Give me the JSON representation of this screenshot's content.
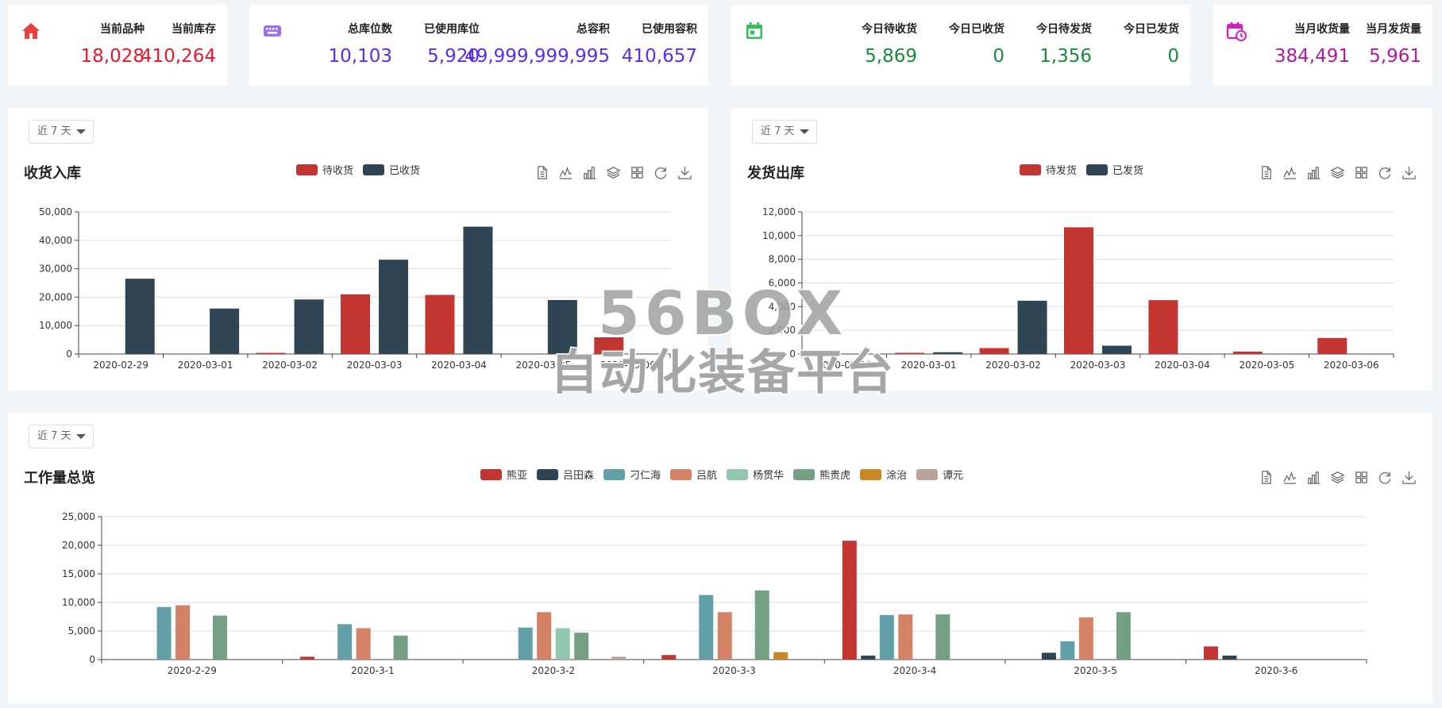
{
  "stats": {
    "card1": {
      "items": [
        {
          "label": "当前品种",
          "value": "18,028",
          "color": "#e8182a"
        },
        {
          "label": "当前库存",
          "value": "410,264",
          "color": "#e8182a"
        }
      ],
      "icon": "home-icon",
      "icon_color": "#e8403a"
    },
    "card2": {
      "items": [
        {
          "label": "总库位数",
          "value": "10,103",
          "color": "#5a2ee8"
        },
        {
          "label": "已使用库位",
          "value": "5,920",
          "color": "#5a2ee8"
        },
        {
          "label": "总容积",
          "value": "49,999,999,995",
          "color": "#5a2ee8"
        },
        {
          "label": "已使用容积",
          "value": "410,657",
          "color": "#5a2ee8"
        }
      ],
      "icon": "keyboard-icon",
      "icon_color": "#9b6fe8"
    },
    "card3": {
      "items": [
        {
          "label": "今日待收货",
          "value": "5,869",
          "color": "#1a8a3c"
        },
        {
          "label": "今日已收货",
          "value": "0",
          "color": "#1a8a3c"
        },
        {
          "label": "今日待发货",
          "value": "1,356",
          "color": "#1a8a3c"
        },
        {
          "label": "今日已发货",
          "value": "0",
          "color": "#1a8a3c"
        }
      ],
      "icon": "calendar-icon",
      "icon_color": "#2ec05a"
    },
    "card4": {
      "items": [
        {
          "label": "当月收货量",
          "value": "384,491",
          "color": "#b01aa0"
        },
        {
          "label": "当月发货量",
          "value": "5,961",
          "color": "#b01aa0"
        }
      ],
      "icon": "calendar-clock-icon",
      "icon_color": "#d420c0"
    }
  },
  "panels": {
    "receiving": {
      "title": "收货入库",
      "range": "近 7 天"
    },
    "shipping": {
      "title": "发货出库",
      "range": "近 7 天"
    },
    "workload": {
      "title": "工作量总览",
      "range": "近 7 天"
    }
  },
  "toolbox": [
    "data-view-icon",
    "line-chart-icon",
    "bar-chart-icon",
    "stack-icon",
    "tiled-icon",
    "restore-icon",
    "download-icon"
  ],
  "watermark": {
    "line1": "56BOX",
    "line2": "自动化装备平台"
  },
  "chart_data": [
    {
      "type": "bar",
      "title": "收货入库",
      "categories": [
        "2020-02-29",
        "2020-03-01",
        "2020-03-02",
        "2020-03-03",
        "2020-03-04",
        "2020-03-05",
        "2020-03-06"
      ],
      "series": [
        {
          "name": "待收货",
          "color": "#c23531",
          "values": [
            0,
            0,
            400,
            21000,
            20800,
            0,
            5869
          ]
        },
        {
          "name": "已收货",
          "color": "#2f4554",
          "values": [
            26500,
            16000,
            19200,
            33200,
            44800,
            19000,
            0
          ]
        }
      ],
      "yticks": [
        "0",
        "10,000",
        "20,000",
        "30,000",
        "40,000",
        "50,000"
      ],
      "ylim": [
        0,
        50000
      ],
      "legend": "top-center",
      "grid": true
    },
    {
      "type": "bar",
      "title": "发货出库",
      "categories": [
        "2020-02-29",
        "2020-03-01",
        "2020-03-02",
        "2020-03-03",
        "2020-03-04",
        "2020-03-05",
        "2020-03-06"
      ],
      "series": [
        {
          "name": "待发货",
          "color": "#c23531",
          "values": [
            0,
            100,
            500,
            10700,
            4550,
            200,
            1356
          ]
        },
        {
          "name": "已发货",
          "color": "#2f4554",
          "values": [
            0,
            150,
            4500,
            700,
            0,
            0,
            0
          ]
        }
      ],
      "yticks": [
        "0",
        "2,000",
        "4,000",
        "6,000",
        "8,000",
        "10,000",
        "12,000"
      ],
      "ylim": [
        0,
        12000
      ],
      "legend": "top-center",
      "grid": true
    },
    {
      "type": "bar",
      "title": "工作量总览",
      "categories": [
        "2020-2-29",
        "2020-3-1",
        "2020-3-2",
        "2020-3-3",
        "2020-3-4",
        "2020-3-5",
        "2020-3-6"
      ],
      "series": [
        {
          "name": "熊亚",
          "color": "#c23531",
          "values": [
            0,
            500,
            0,
            800,
            20800,
            0,
            2300
          ]
        },
        {
          "name": "吕田森",
          "color": "#2f4554",
          "values": [
            0,
            0,
            0,
            0,
            700,
            1200,
            700
          ]
        },
        {
          "name": "刁仁海",
          "color": "#61a0a8",
          "values": [
            9200,
            6200,
            5600,
            11300,
            7800,
            3200,
            0
          ]
        },
        {
          "name": "吕航",
          "color": "#d48265",
          "values": [
            9500,
            5500,
            8300,
            8300,
            7900,
            7400,
            0
          ]
        },
        {
          "name": "杨贯华",
          "color": "#91c7ae",
          "values": [
            0,
            0,
            5500,
            0,
            0,
            0,
            0
          ]
        },
        {
          "name": "熊贵虎",
          "color": "#749f83",
          "values": [
            7700,
            4200,
            4700,
            12100,
            7900,
            8300,
            0
          ]
        },
        {
          "name": "涂治",
          "color": "#ca8622",
          "values": [
            0,
            0,
            0,
            1300,
            0,
            0,
            0
          ]
        },
        {
          "name": "谭元",
          "color": "#bda29a",
          "values": [
            0,
            0,
            500,
            0,
            0,
            0,
            0
          ]
        }
      ],
      "yticks": [
        "0",
        "5,000",
        "10,000",
        "15,000",
        "20,000",
        "25,000"
      ],
      "ylim": [
        0,
        25000
      ],
      "legend": "top-center",
      "grid": true
    }
  ]
}
